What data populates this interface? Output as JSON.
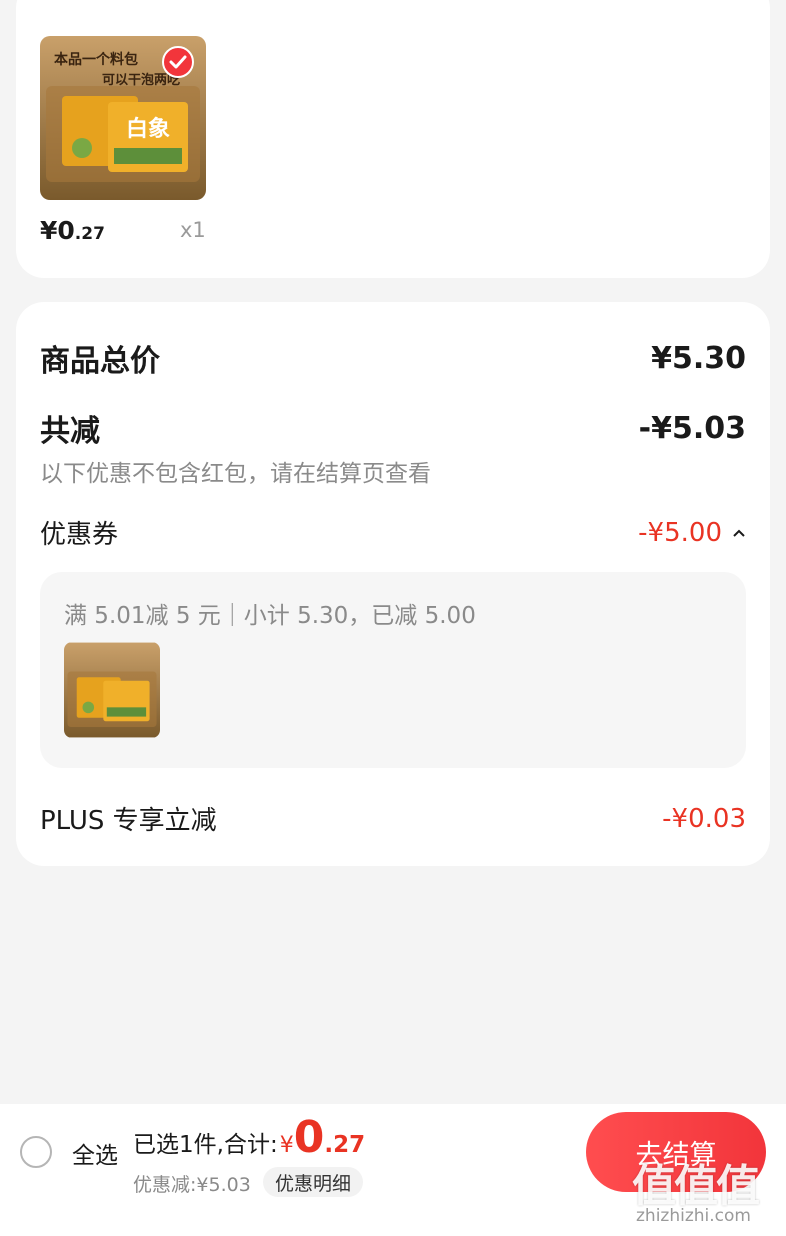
{
  "item": {
    "image_text_1": "本品一个料包",
    "image_text_2": "可以干泡两吃",
    "image_brand": "白象",
    "price_int": "¥0",
    "price_dec": ".27",
    "qty": "x1"
  },
  "summary": {
    "goods_total_label": "商品总价",
    "goods_total_value": "¥5.30",
    "reduction_label": "共减",
    "reduction_value": "-¥5.03",
    "note": "以下优惠不包含红包，请在结算页查看",
    "coupon_label": "优惠券",
    "coupon_value": "-¥5.00",
    "coupon_desc": "满 5.01减 5 元｜小计 5.30，已减 5.00",
    "plus_label": "PLUS 专享立减",
    "plus_value": "-¥0.03"
  },
  "bottom": {
    "select_all": "全选",
    "selected_prefix": "已选1件,合计:",
    "currency": "¥",
    "total_int": "0",
    "total_dec": ".27",
    "discount": "优惠减:¥5.03",
    "detail_button": "优惠明细",
    "checkout_button": "去结算"
  },
  "watermark": {
    "big": "值值值",
    "small": "zhizhizhi.com"
  },
  "colors": {
    "accent_red": "#e93323",
    "button_red": "#f2353b"
  }
}
